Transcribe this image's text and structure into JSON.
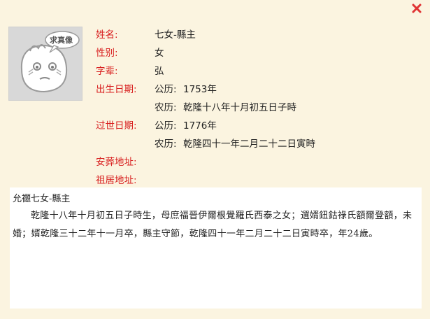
{
  "colors": {
    "label": "#d82020",
    "close": "#e03434",
    "page_background": "#fbf4e0"
  },
  "close_icon": "close-icon",
  "avatar": {
    "badge_text": "求真像"
  },
  "fields": {
    "name": {
      "label": "姓名:",
      "value": "七女-縣主"
    },
    "gender": {
      "label": "性别:",
      "value": "女"
    },
    "generation": {
      "label": "字辈:",
      "value": "弘"
    },
    "birth": {
      "label": "出生日期:",
      "gregorian_label": "公历:",
      "gregorian_value": "1753年",
      "lunar_label": "农历:",
      "lunar_value": "乾隆十八年十月初五日子時"
    },
    "death": {
      "label": "过世日期:",
      "gregorian_label": "公历:",
      "gregorian_value": "1776年",
      "lunar_label": "农历:",
      "lunar_value": "乾隆四十一年二月二十二日寅時"
    },
    "burial": {
      "label": "安葬地址:",
      "value": ""
    },
    "residence": {
      "label": "祖居地址:",
      "value": ""
    }
  },
  "bio": {
    "title": "允禵七女-縣主",
    "text": "乾隆十八年十月初五日子時生，母庶福晉伊爾根覺羅氏西泰之女；選婿鈕鈷祿氏額爾登額，未婚；婿乾隆三十二年十一月卒，縣主守節，乾隆四十一年二月二十二日寅時卒，年24歲。"
  }
}
